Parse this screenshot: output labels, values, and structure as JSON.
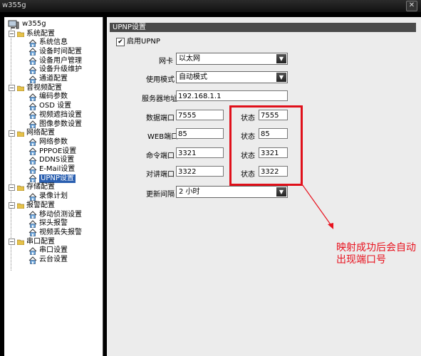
{
  "window": {
    "title": "w355g",
    "close_glyph": "✕"
  },
  "tree": {
    "root": "w355g",
    "groups": [
      {
        "label": "系统配置",
        "items": [
          "系统信息",
          "设备时间配置",
          "设备用户管理",
          "设备升级维护",
          "通道配置"
        ]
      },
      {
        "label": "音视频配置",
        "items": [
          "编码参数",
          "OSD 设置",
          "视频遮挡设置",
          "图像参数设置"
        ]
      },
      {
        "label": "网络配置",
        "items": [
          "网络参数",
          "PPPOE设置",
          "DDNS设置",
          "E-Mail设置",
          "UPNP设置"
        ]
      },
      {
        "label": "存储配置",
        "items": [
          "录像计划"
        ]
      },
      {
        "label": "报警配置",
        "items": [
          "移动侦测设置",
          "探头报警",
          "视频丢失报警"
        ]
      },
      {
        "label": "串口配置",
        "items": [
          "串口设置",
          "云台设置"
        ]
      }
    ],
    "selected": "UPNP设置"
  },
  "panel": {
    "section_title": "UPNP设置",
    "enable_label": "启用UPNP",
    "enable_checked": true,
    "nic_label": "网卡",
    "nic_value": "以太网",
    "mode_label": "使用模式",
    "mode_value": "自动模式",
    "server_label": "服务器地址",
    "server_value": "192.168.1.1",
    "ports": [
      {
        "label": "数据端口",
        "value": "7555",
        "status_label": "状态",
        "status_value": "7555"
      },
      {
        "label": "WEB端口",
        "value": "85",
        "status_label": "状态",
        "status_value": "85"
      },
      {
        "label": "命令端口",
        "value": "3321",
        "status_label": "状态",
        "status_value": "3321"
      },
      {
        "label": "对讲端口",
        "value": "3322",
        "status_label": "状态",
        "status_value": "3322"
      }
    ],
    "interval_label": "更新间隔",
    "interval_value": "2 小时"
  },
  "annotation": {
    "text": "映射成功后会自动出现端口号",
    "color": "#e8121e"
  },
  "colors": {
    "highlight": "#e0101a",
    "selection": "#2a5fb0"
  }
}
